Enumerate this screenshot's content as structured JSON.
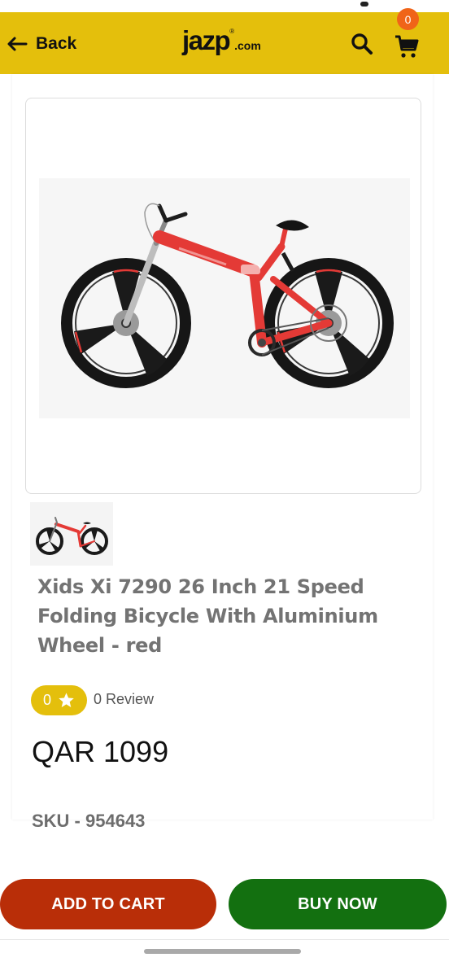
{
  "header": {
    "back_label": "Back",
    "logo_main": "jazp",
    "logo_reg": "®",
    "logo_suffix": ".com",
    "cart_count": "0",
    "accent_color": "#e4bf0c",
    "badge_color": "#f06418",
    "icons": [
      "arrow-left-icon",
      "search-icon",
      "cart-icon"
    ]
  },
  "product": {
    "image_icon": "folding-bicycle-image",
    "frame_color": "#e43a36",
    "title_line1": "Xids Xi 7290 26 Inch 21 Speed",
    "title_line2": "Folding Bicycle With Aluminium",
    "title_line3": "Wheel - red",
    "rating_value": "0",
    "review_text": "0 Review",
    "price": "QAR 1099",
    "sku": "SKU - 954643"
  },
  "actions": {
    "add_to_cart_label": "ADD TO CART",
    "buy_now_label": "BUY NOW",
    "add_to_cart_color": "#b92e08",
    "buy_now_color": "#137010"
  }
}
